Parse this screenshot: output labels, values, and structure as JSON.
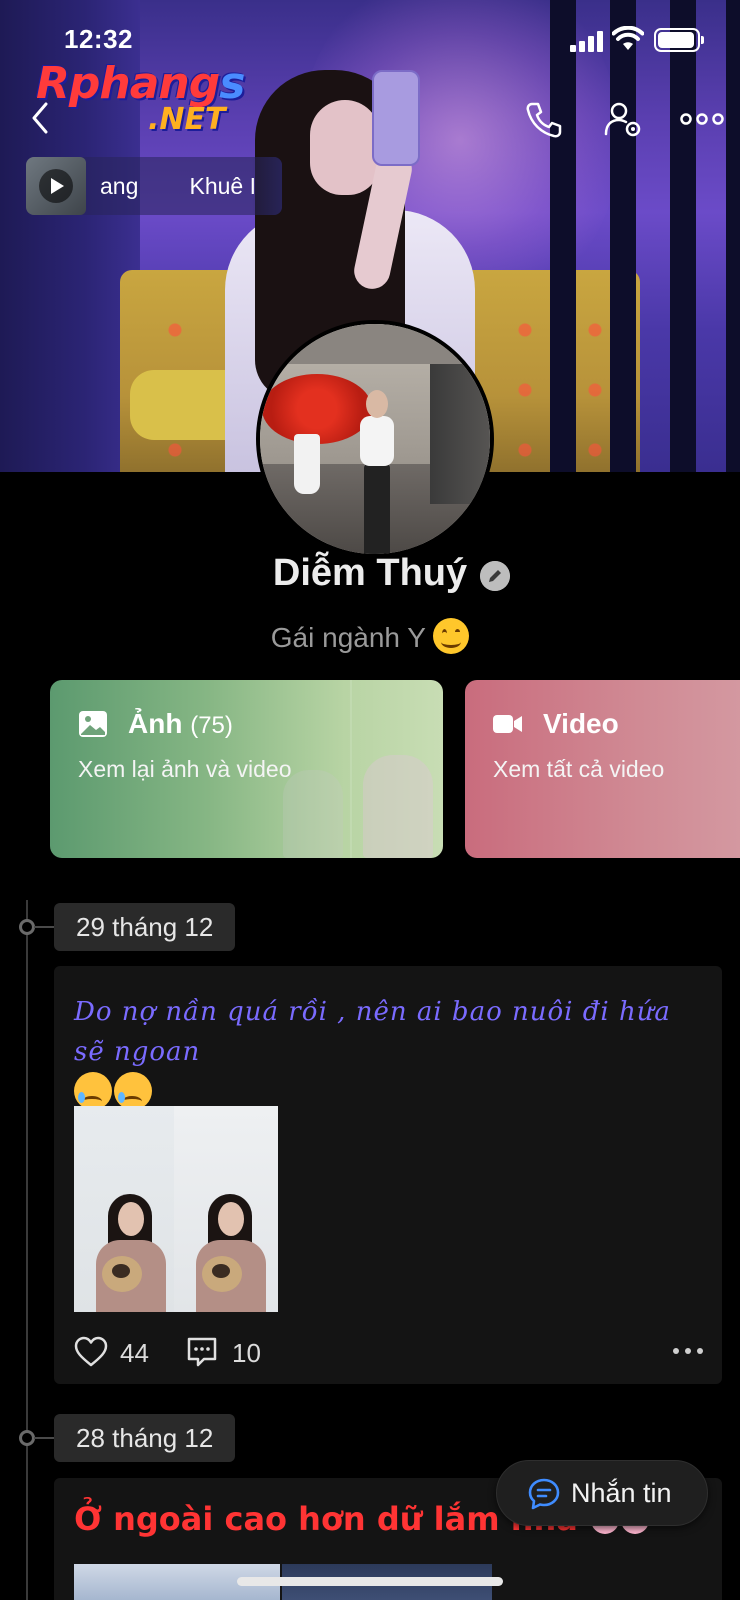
{
  "status_bar": {
    "time": "12:32"
  },
  "watermark": {
    "part1": "Rphang",
    "part2": "s",
    "part3": ".NET"
  },
  "header": {
    "icons": [
      "back-chevron-icon",
      "phone-call-icon",
      "profile-settings-icon",
      "more-dots-icon"
    ]
  },
  "music": {
    "ticker_text": "ang        Khuê I"
  },
  "profile": {
    "name": "Diễm Thuý",
    "bio": "Gái ngành Y"
  },
  "media_cards": {
    "photos": {
      "title": "Ảnh",
      "count": "(75)",
      "subtitle": "Xem lại ảnh và video"
    },
    "videos": {
      "title": "Video",
      "subtitle": "Xem tất cả video"
    }
  },
  "timeline": [
    {
      "date": "29 tháng 12",
      "text": "Do nợ nần quá rồi , nên ai bao nuôi đi hứa sẽ ngoan",
      "likes": "44",
      "comments": "10"
    },
    {
      "date": "28 tháng 12",
      "text": "Ở ngoài cao hơn dữ lắm nha"
    }
  ],
  "fab": {
    "label": "Nhắn tin"
  },
  "colors": {
    "background": "#000000",
    "post_bg": "#141414",
    "script_text": "#7a6bff",
    "red_text": "#ff3434",
    "photo_card": "#86b684",
    "video_card": "#d08a94"
  }
}
